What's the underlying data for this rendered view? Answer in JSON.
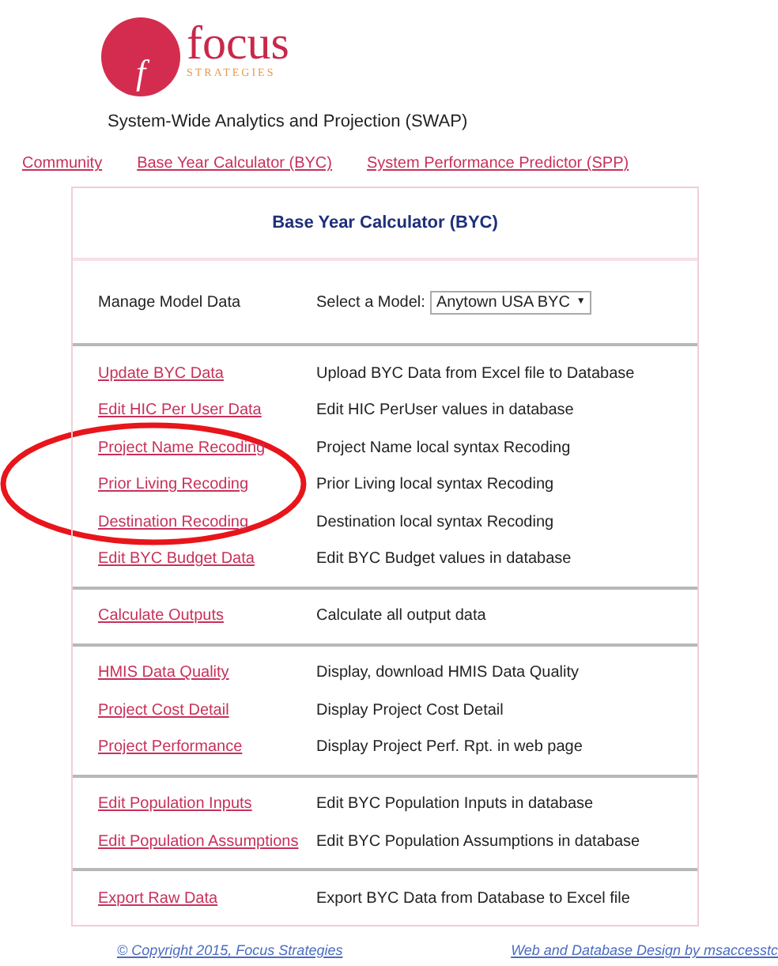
{
  "logo": {
    "monogram": "f",
    "name": "focus",
    "tagline": "STRATEGIES"
  },
  "subtitle": "System-Wide Analytics and Projection (SWAP)",
  "nav": [
    "Community",
    "Base Year Calculator (BYC)",
    "System Performance Predictor (SPP)"
  ],
  "panel": {
    "title": "Base Year Calculator (BYC)",
    "manage": {
      "label": "Manage Model Data",
      "select_label": "Select a Model:",
      "select_value": "Anytown USA BYC",
      "caret": "▼"
    },
    "groups": [
      [
        {
          "link": "Update BYC Data",
          "description": "Upload BYC Data from Excel file to Database"
        },
        {
          "link": "Edit HIC Per User Data",
          "description": "Edit HIC PerUser values in database"
        },
        {
          "link": "Project Name Recoding",
          "description": "Project Name local syntax Recoding"
        },
        {
          "link": "Prior Living Recoding",
          "description": "Prior Living local syntax Recoding"
        },
        {
          "link": "Destination Recoding",
          "description": "Destination local syntax Recoding"
        },
        {
          "link": "Edit BYC Budget Data",
          "description": "Edit BYC Budget values in database"
        }
      ],
      [
        {
          "link": "Calculate Outputs",
          "description": "Calculate all output data"
        }
      ],
      [
        {
          "link": "HMIS Data Quality",
          "description": "Display, download HMIS Data Quality"
        },
        {
          "link": "Project Cost Detail",
          "description": "Display Project Cost Detail"
        },
        {
          "link": "Project Performance",
          "description": "Display Project Perf. Rpt. in web page"
        }
      ],
      [
        {
          "link": "Edit Population Inputs",
          "description": "Edit BYC Population Inputs in database"
        },
        {
          "link": "Edit Population Assumptions",
          "description": "Edit BYC Population Assumptions in database"
        }
      ],
      [
        {
          "link": "Export Raw Data",
          "description": "Export BYC Data from Database to Excel file"
        }
      ]
    ]
  },
  "annotation": {
    "kind": "ellipse"
  },
  "footer": {
    "left": "© Copyright 2015, Focus Strategies",
    "right": "Web and Database Design by msaccesstc"
  }
}
